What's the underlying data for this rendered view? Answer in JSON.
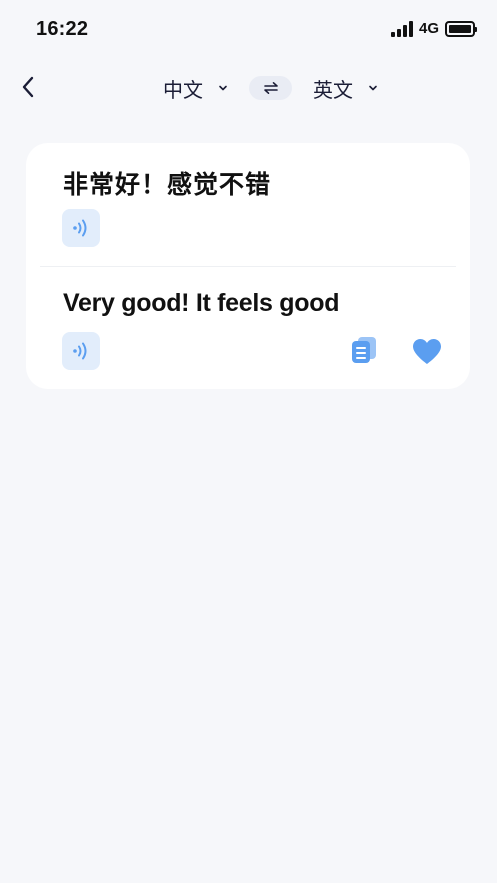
{
  "status_bar": {
    "time": "16:22",
    "network": "4G",
    "battery_level": 1.0
  },
  "header": {
    "source_language": "中文",
    "target_language": "英文",
    "swap_icon": "swap-arrows-icon"
  },
  "translation": {
    "source_text": "非常好！感觉不错",
    "target_text": "Very good! It feels good"
  },
  "colors": {
    "accent": "#5b9ef0",
    "speaker_bg": "#e2edfb",
    "page_bg": "#f6f7fa",
    "card_bg": "#ffffff"
  }
}
